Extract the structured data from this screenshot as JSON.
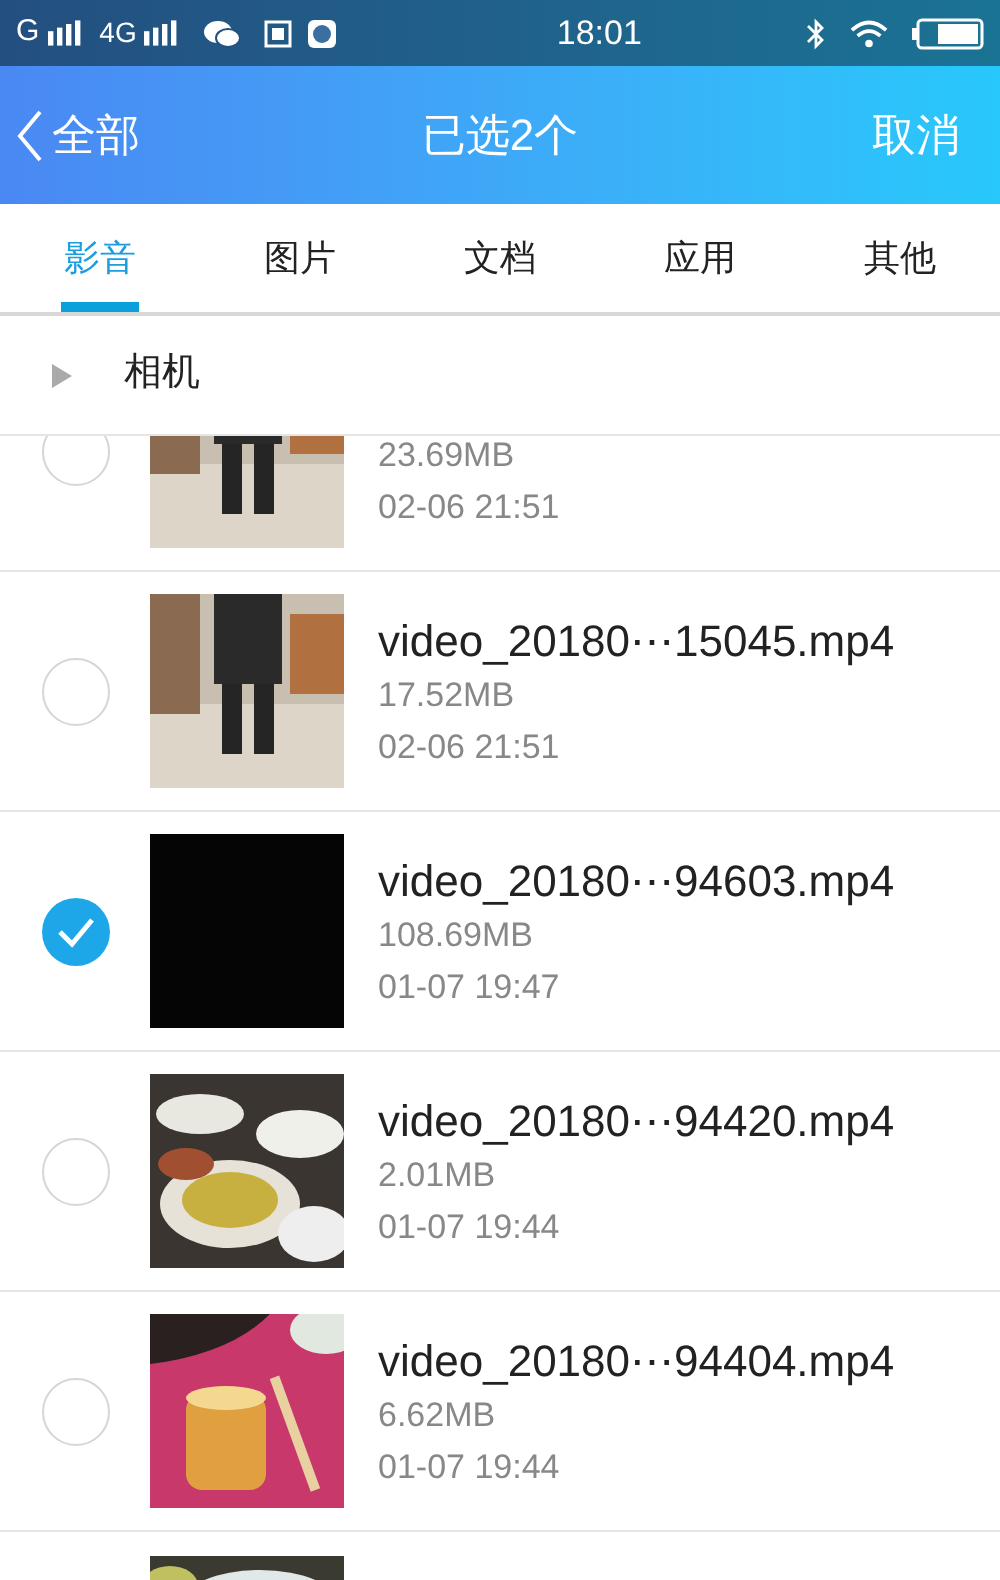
{
  "status_bar": {
    "network_1": "G",
    "network_2": "4G",
    "time": "18:01"
  },
  "header": {
    "back": "全部",
    "title": "已选2个",
    "action": "取消"
  },
  "tabs": [
    {
      "label": "影音",
      "selected": true
    },
    {
      "label": "图片",
      "selected": false
    },
    {
      "label": "文档",
      "selected": false
    },
    {
      "label": "应用",
      "selected": false
    },
    {
      "label": "其他",
      "selected": false
    }
  ],
  "folder": {
    "name": "相机",
    "expanded": false
  },
  "files": [
    {
      "size": "23.69MB",
      "date": "02-06 21:51",
      "selected": false
    },
    {
      "name": "video_20180⋯15045.mp4",
      "size": "17.52MB",
      "date": "02-06 21:51",
      "selected": false
    },
    {
      "name": "video_20180⋯94603.mp4",
      "size": "108.69MB",
      "date": "01-07 19:47",
      "selected": true
    },
    {
      "name": "video_20180⋯94420.mp4",
      "size": "2.01MB",
      "date": "01-07 19:44",
      "selected": false
    },
    {
      "name": "video_20180⋯94404.mp4",
      "size": "6.62MB",
      "date": "01-07 19:44",
      "selected": false
    }
  ]
}
